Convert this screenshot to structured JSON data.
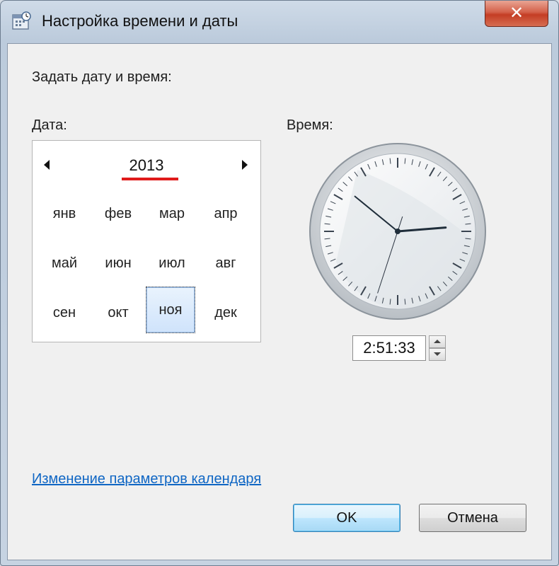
{
  "window": {
    "title": "Настройка времени и даты",
    "close_label": "✕"
  },
  "heading": "Задать дату и время:",
  "date": {
    "label": "Дата:",
    "year": "2013",
    "months": [
      "янв",
      "фев",
      "мар",
      "апр",
      "май",
      "июн",
      "июл",
      "авг",
      "сен",
      "окт",
      "ноя",
      "дек"
    ],
    "selected_month": "ноя"
  },
  "time": {
    "label": "Время:",
    "value": "2:51:33",
    "hours": 2,
    "minutes": 51,
    "seconds": 33
  },
  "link": "Изменение параметров календаря",
  "buttons": {
    "ok": "OK",
    "cancel": "Отмена"
  },
  "colors": {
    "accent_underline": "#e01b1b",
    "link": "#0f66c4"
  }
}
